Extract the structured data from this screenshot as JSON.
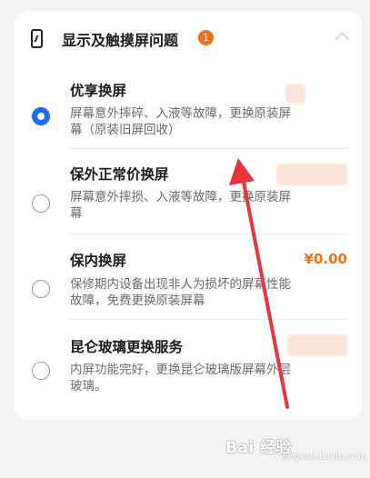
{
  "section": {
    "title": "显示及触摸屏问题",
    "badge_count": "1",
    "expanded": true
  },
  "options": [
    {
      "name": "优享换屏",
      "description": "屏幕意外摔碎、入液等故障，更换原装屏幕（原装旧屏回收）",
      "selected": true,
      "price": ""
    },
    {
      "name": "保外正常价换屏",
      "description": "屏幕意外摔损、入液等故障，更换原装屏幕",
      "selected": false,
      "price": ""
    },
    {
      "name": "保内换屏",
      "description": "保修期内设备出现非人为损坏的屏幕性能故障，免费更换原装屏幕",
      "selected": false,
      "price": "¥0.00"
    },
    {
      "name": "昆仑玻璃更换服务",
      "description": "内屏功能完好，更换昆仑玻璃版屏幕外层玻璃。",
      "selected": false,
      "price": ""
    }
  ],
  "watermark": {
    "brand": "Bai 经验",
    "domain": "jingyan.baidu.com"
  },
  "colors": {
    "accent": "#1f6bff",
    "price": "#e8731e",
    "badge": "#f26d1f",
    "annotation_arrow": "#e8343c"
  }
}
